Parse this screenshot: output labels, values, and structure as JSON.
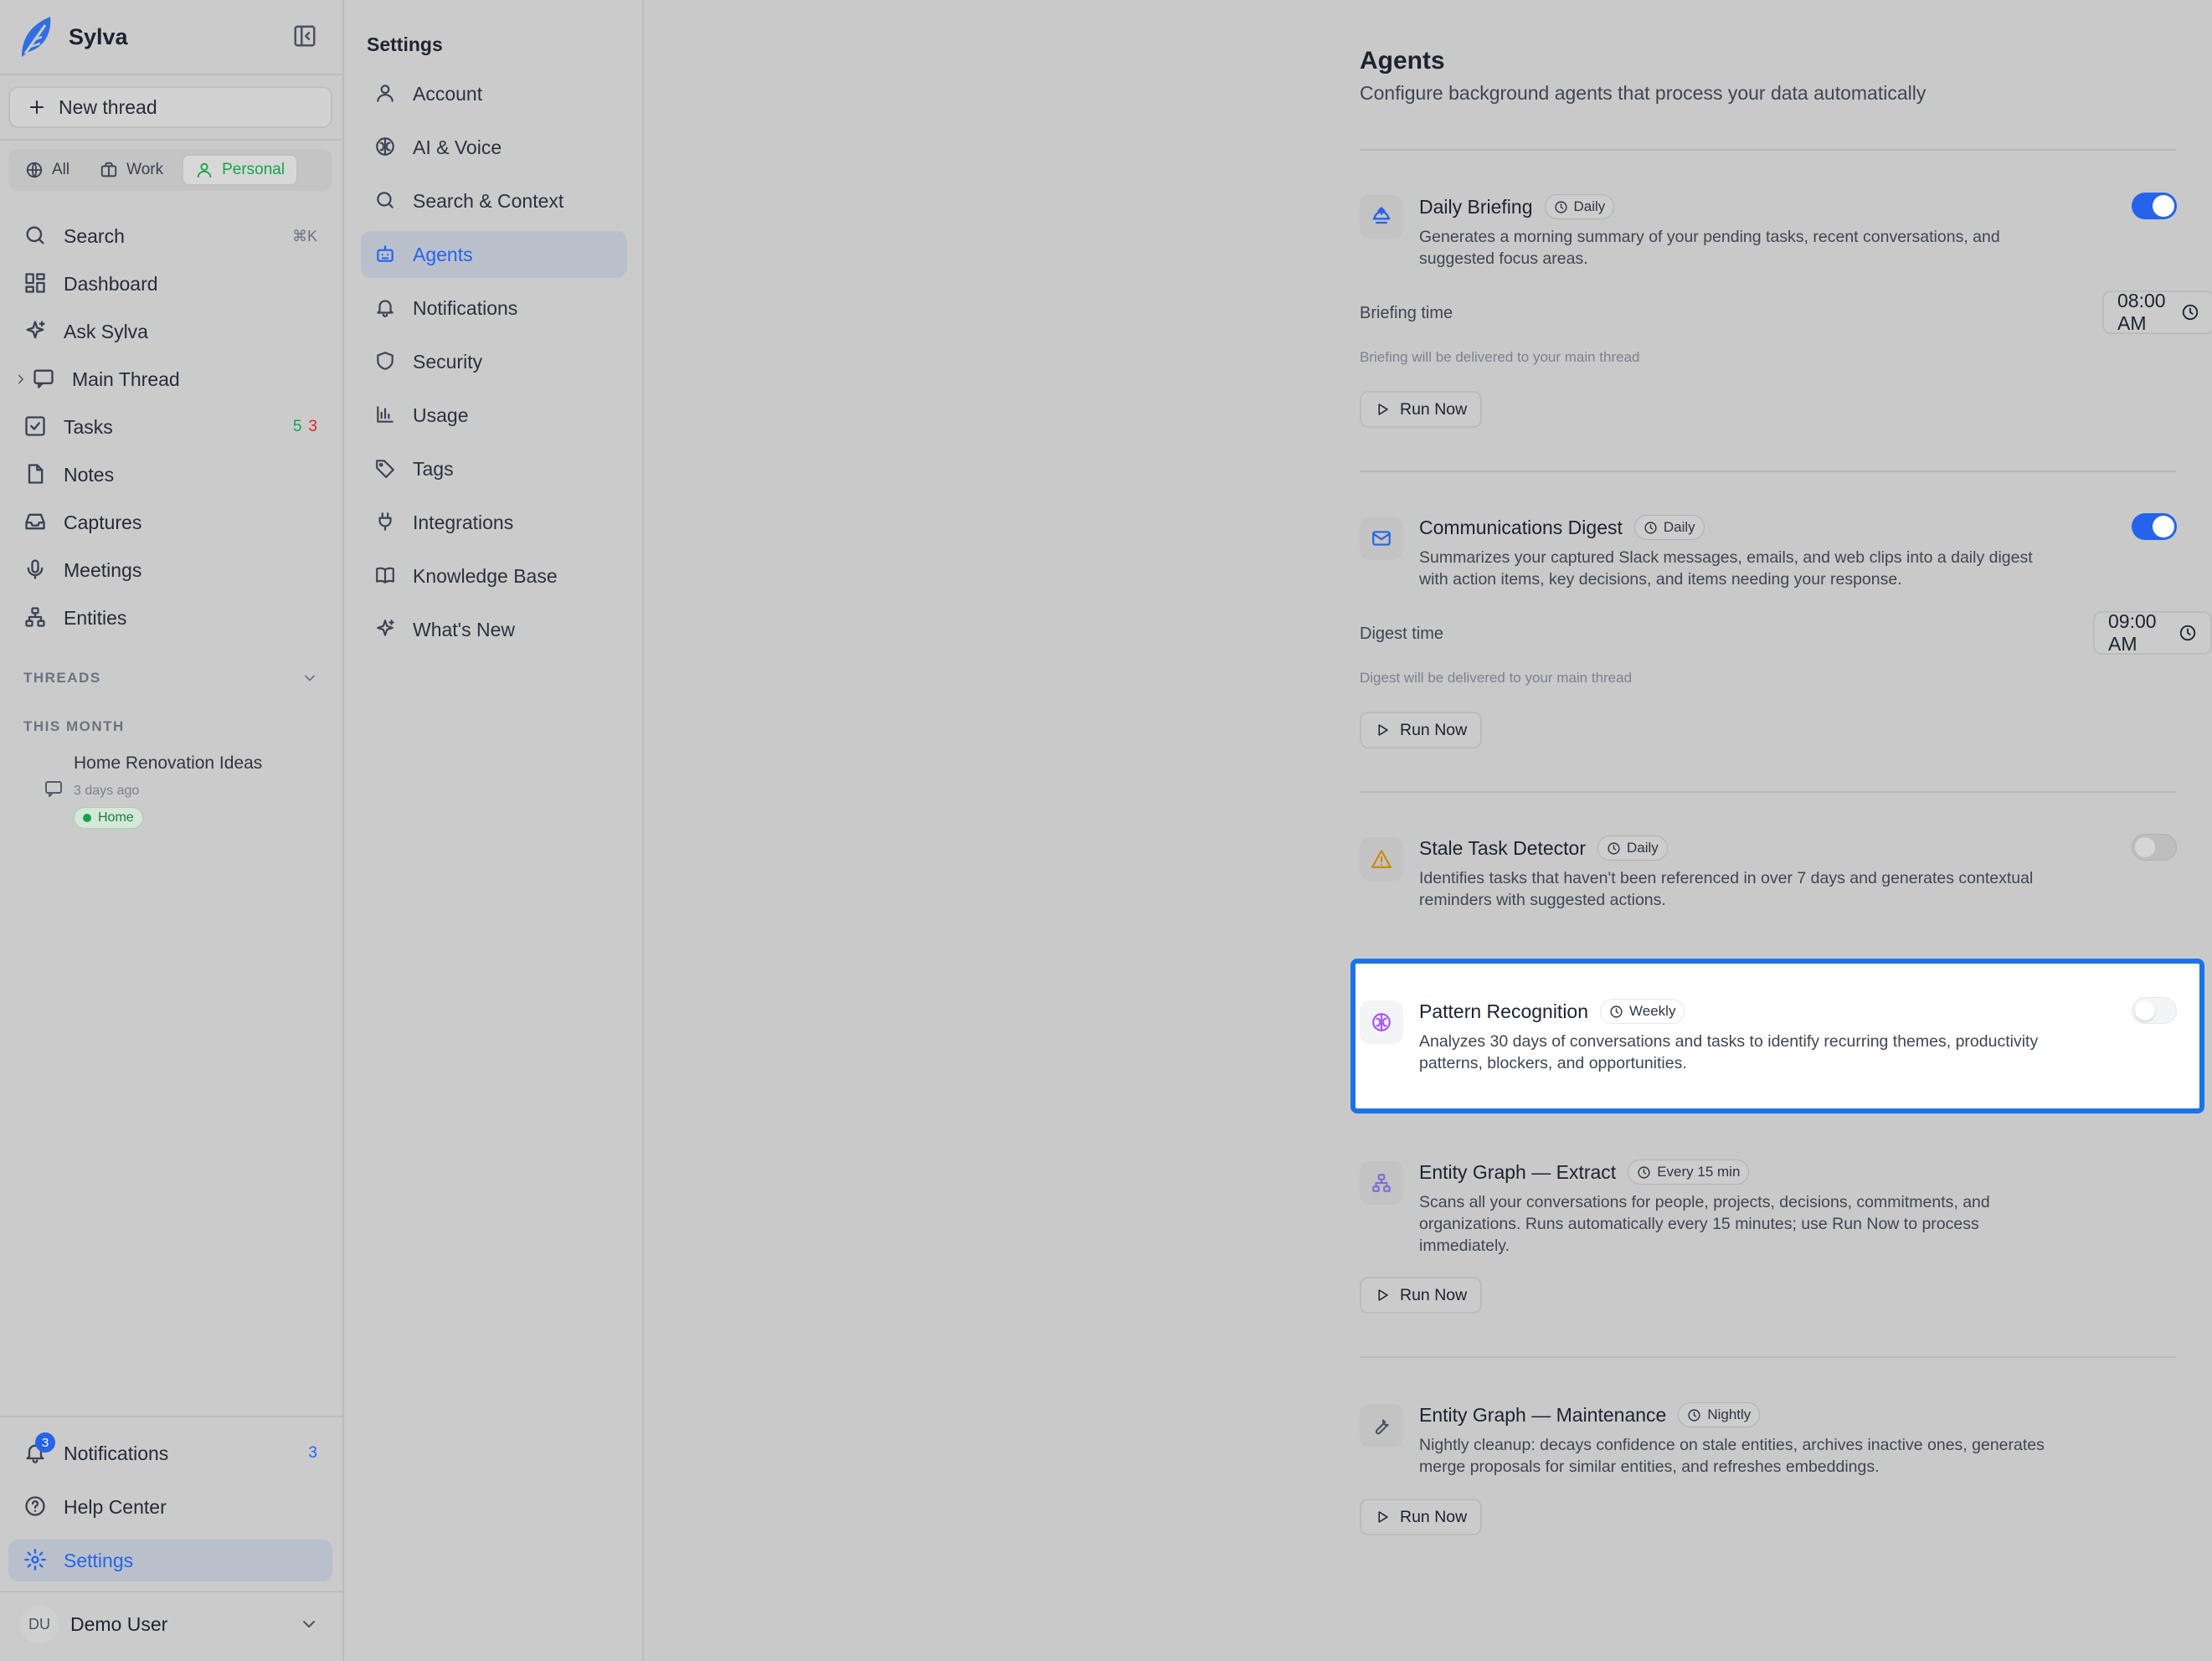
{
  "app": {
    "name": "Sylva"
  },
  "sidebar": {
    "new_thread": "New thread",
    "scopes": [
      {
        "label": "All",
        "active": false
      },
      {
        "label": "Work",
        "active": false
      },
      {
        "label": "Personal",
        "active": true
      }
    ],
    "nav": [
      {
        "label": "Search",
        "shortcut": "⌘K",
        "icon": "search-icon"
      },
      {
        "label": "Dashboard",
        "icon": "dashboard-icon"
      },
      {
        "label": "Ask Sylva",
        "icon": "sparkles-icon"
      },
      {
        "label": "Main Thread",
        "icon": "message-icon"
      },
      {
        "label": "Tasks",
        "icon": "check-square-icon",
        "count_open": "5",
        "count_overdue": "3"
      },
      {
        "label": "Notes",
        "icon": "file-icon"
      },
      {
        "label": "Captures",
        "icon": "inbox-icon"
      },
      {
        "label": "Meetings",
        "icon": "mic-icon"
      },
      {
        "label": "Entities",
        "icon": "network-icon"
      }
    ],
    "threads_label": "THREADS",
    "this_month_label": "THIS MONTH",
    "threads": [
      {
        "title": "Home Renovation Ideas",
        "time": "3 days ago",
        "tag": "Home"
      }
    ],
    "bottom": {
      "notifications": {
        "label": "Notifications",
        "count": "3",
        "badge": "3"
      },
      "help": "Help Center",
      "settings": "Settings"
    },
    "user": {
      "initials": "DU",
      "name": "Demo User"
    }
  },
  "settings_nav": {
    "title": "Settings",
    "items": [
      {
        "label": "Account",
        "icon": "user-icon"
      },
      {
        "label": "AI & Voice",
        "icon": "brain-icon"
      },
      {
        "label": "Search & Context",
        "icon": "search-icon"
      },
      {
        "label": "Agents",
        "icon": "bot-icon",
        "active": true
      },
      {
        "label": "Notifications",
        "icon": "bell-icon"
      },
      {
        "label": "Security",
        "icon": "shield-icon"
      },
      {
        "label": "Usage",
        "icon": "bar-chart-icon"
      },
      {
        "label": "Tags",
        "icon": "tag-icon"
      },
      {
        "label": "Integrations",
        "icon": "plug-icon"
      },
      {
        "label": "Knowledge Base",
        "icon": "book-icon"
      },
      {
        "label": "What's New",
        "icon": "sparkles-icon"
      }
    ]
  },
  "main": {
    "title": "Agents",
    "subtitle": "Configure background agents that process your data automatically",
    "run_now": "Run Now",
    "agents": [
      {
        "name": "Daily Briefing",
        "frequency": "Daily",
        "enabled": true,
        "icon": "sunrise-icon",
        "description": "Generates a morning summary of your pending tasks, recent conversations, and suggested focus areas.",
        "time_label": "Briefing time",
        "time_value": "08:00 AM",
        "hint": "Briefing will be delivered to your main thread"
      },
      {
        "name": "Communications Digest",
        "frequency": "Daily",
        "enabled": true,
        "icon": "mail-icon",
        "description": "Summarizes your captured Slack messages, emails, and web clips into a daily digest with action items, key decisions, and items needing your response.",
        "time_label": "Digest time",
        "time_value": "09:00 AM",
        "hint": "Digest will be delivered to your main thread"
      },
      {
        "name": "Stale Task Detector",
        "frequency": "Daily",
        "enabled": false,
        "icon": "warning-icon",
        "description": "Identifies tasks that haven't been referenced in over 7 days and generates contextual reminders with suggested actions."
      },
      {
        "name": "Pattern Recognition",
        "frequency": "Weekly",
        "enabled": false,
        "icon": "brain-icon",
        "description": "Analyzes 30 days of conversations and tasks to identify recurring themes, productivity patterns, blockers, and opportunities."
      },
      {
        "name": "Entity Graph — Extract",
        "frequency": "Every 15 min",
        "icon": "network-icon",
        "description": "Scans all your conversations for people, projects, decisions, commitments, and organizations. Runs automatically every 15 minutes; use Run Now to process immediately."
      },
      {
        "name": "Entity Graph — Maintenance",
        "frequency": "Nightly",
        "icon": "wrench-icon",
        "description": "Nightly cleanup: decays confidence on stale entities, archives inactive ones, generates merge proposals for similar entities, and refreshes embeddings."
      }
    ]
  },
  "colors": {
    "accent": "#2563eb",
    "highlight": "#1a73e8",
    "success": "#16a34a",
    "danger": "#dc2626"
  }
}
